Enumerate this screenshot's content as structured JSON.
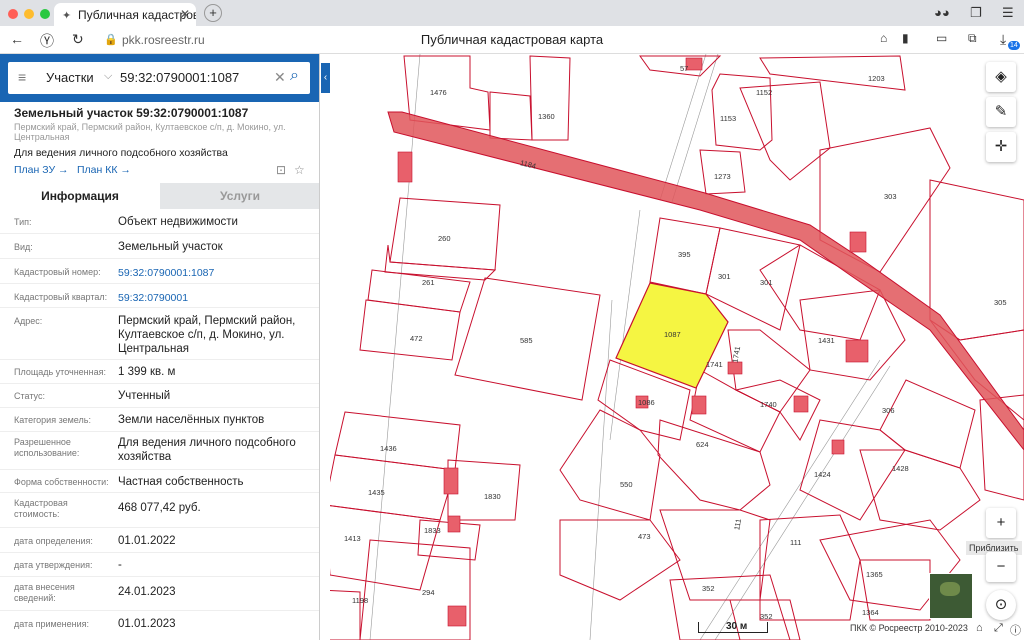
{
  "browser": {
    "tab_title": "Публичная кадастровая",
    "url": "pkk.rosreestr.ru",
    "page_title": "Публичная кадастровая карта",
    "downloads_badge": "14"
  },
  "search": {
    "type_label": "Участки",
    "query": "59:32:0790001:1087"
  },
  "object": {
    "title": "Земельный участок 59:32:0790001:1087",
    "address_short": "Пермский край, Пермский район, Култаевское с/п, д. Мокино, ул. Центральная",
    "use": "Для ведения личного подсобного хозяйства",
    "plan_zu": "План ЗУ",
    "plan_kk": "План КК"
  },
  "tabs": {
    "info": "Информация",
    "services": "Услуги"
  },
  "fields": [
    {
      "label": "Тип:",
      "value": "Объект недвижимости"
    },
    {
      "label": "Вид:",
      "value": "Земельный участок"
    },
    {
      "label": "Кадастровый номер:",
      "value": "59:32:0790001:1087"
    },
    {
      "label": "Кадастровый квартал:",
      "value": "59:32:0790001"
    },
    {
      "label": "Адрес:",
      "value": "Пермский край, Пермский район, Култаевское с/п, д. Мокино, ул. Центральная"
    },
    {
      "label": "Площадь уточненная:",
      "value": "1 399 кв. м"
    },
    {
      "label": "Статус:",
      "value": "Учтенный"
    },
    {
      "label": "Категория земель:",
      "value": "Земли населённых пунктов"
    },
    {
      "label": "Разрешенное использование:",
      "value": "Для ведения личного подсобного хозяйства"
    },
    {
      "label": "Форма собственности:",
      "value": "Частная собственность"
    },
    {
      "label": "Кадастровая стоимость:",
      "value": "468 077,42 руб."
    },
    {
      "label": "дата определения:",
      "value": "01.01.2022"
    },
    {
      "label": "дата утверждения:",
      "value": "-"
    },
    {
      "label": "дата внесения сведений:",
      "value": "24.01.2023"
    },
    {
      "label": "дата применения:",
      "value": "01.01.2023"
    }
  ],
  "map": {
    "parcel_labels": [
      "57",
      "1203",
      "1476",
      "1360",
      "1153",
      "1152",
      "1184",
      "1273",
      "303",
      "260",
      "395",
      "301",
      "301",
      "261",
      "585",
      "1087",
      "1431",
      "305",
      "472",
      "1741",
      "1741",
      "1086",
      "1740",
      "306",
      "1436",
      "624",
      "1424",
      "1428",
      "1435",
      "1830",
      "550",
      "1833",
      "473",
      "1413",
      "111",
      "111",
      "294",
      "352",
      "1365",
      "1198",
      "352",
      "1364"
    ],
    "zoom_in_tooltip": "Приблизить",
    "scale_label": "30 м",
    "copyright": "ПКК © Росреестр 2010-2023",
    "colors": {
      "selected_fill": "#f5f542",
      "boundary": "#c8102e",
      "road": "#e0565b",
      "building": "#e8606b"
    }
  }
}
